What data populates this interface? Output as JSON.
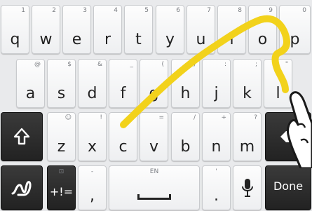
{
  "rows": [
    {
      "keys": [
        {
          "main": "q",
          "hint": "1"
        },
        {
          "main": "w",
          "hint": "2"
        },
        {
          "main": "e",
          "hint": "3"
        },
        {
          "main": "r",
          "hint": "4"
        },
        {
          "main": "t",
          "hint": "5"
        },
        {
          "main": "y",
          "hint": "6"
        },
        {
          "main": "u",
          "hint": "7"
        },
        {
          "main": "i",
          "hint": "8"
        },
        {
          "main": "o",
          "hint": "9"
        },
        {
          "main": "p",
          "hint": "0"
        }
      ]
    },
    {
      "keys": [
        {
          "main": "a",
          "hint": "@"
        },
        {
          "main": "s",
          "hint": "$"
        },
        {
          "main": "d",
          "hint": "&"
        },
        {
          "main": "f",
          "hint": "_"
        },
        {
          "main": "g",
          "hint": "("
        },
        {
          "main": "h",
          "hint": ")"
        },
        {
          "main": "j",
          "hint": ":"
        },
        {
          "main": "k",
          "hint": ";"
        },
        {
          "main": "l",
          "hint": "\""
        }
      ]
    },
    {
      "keys": [
        {
          "main": "z",
          "hint": "☺"
        },
        {
          "main": "x",
          "hint": "!"
        },
        {
          "main": "c",
          "hint": "#"
        },
        {
          "main": "v",
          "hint": "="
        },
        {
          "main": "b",
          "hint": "/"
        },
        {
          "main": "n",
          "hint": "+"
        },
        {
          "main": "m",
          "hint": "?"
        }
      ]
    }
  ],
  "shift": {
    "icon": "shift-arrow-icon"
  },
  "backspace": {
    "icon": "backspace-icon"
  },
  "swype": {
    "icon": "swype-logo-icon"
  },
  "symbols": {
    "label": "+!=",
    "hint": "⊡"
  },
  "comma": {
    "main": ",",
    "hint": "-"
  },
  "space": {
    "hint": "EN",
    "icon": "spacebar-icon"
  },
  "period": {
    "main": ".",
    "hint": "'"
  },
  "mic": {
    "icon": "microphone-icon"
  },
  "done": {
    "label": "Done"
  },
  "trail_color": "#f2d21b"
}
